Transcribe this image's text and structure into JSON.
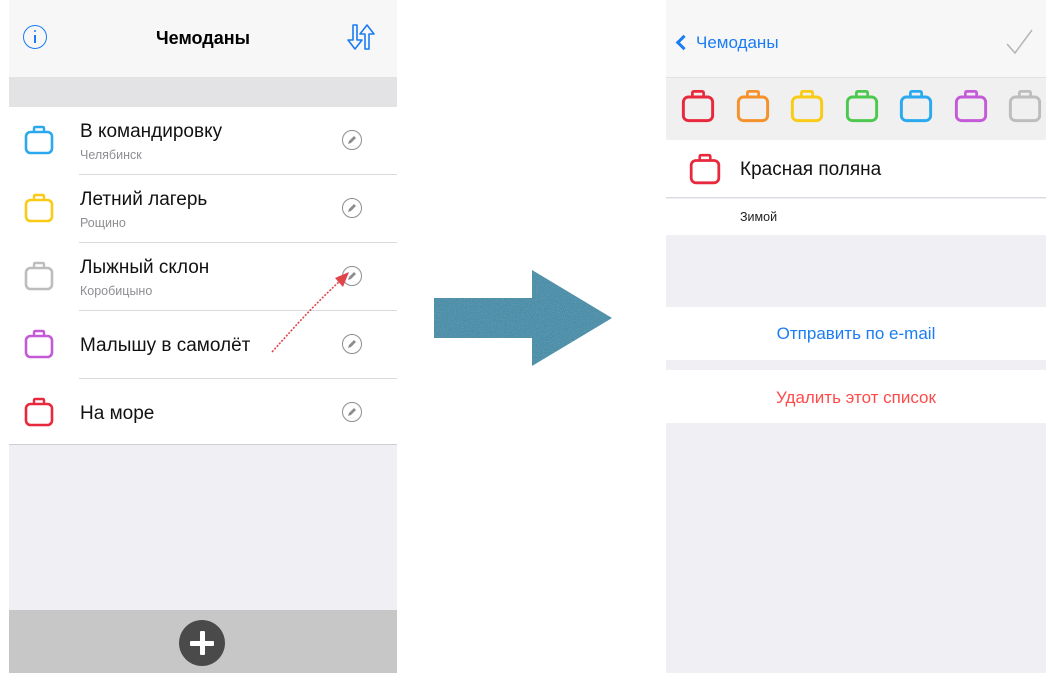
{
  "left": {
    "title": "Чемоданы",
    "icons": {
      "info": "info-icon",
      "sort": "sort-arrows-icon",
      "add": "plus-icon",
      "edit": "pencil-icon"
    },
    "items": [
      {
        "title": "В командировку",
        "subtitle": "Челябинск",
        "color": "#2aa9ef"
      },
      {
        "title": "Летний лагерь",
        "subtitle": "Рощино",
        "color": "#f9cb16"
      },
      {
        "title": "Лыжный склон",
        "subtitle": "Коробицыно",
        "color": "#bdbdbd"
      },
      {
        "title": "Малышу в самолёт",
        "subtitle": "",
        "color": "#c45ad8"
      },
      {
        "title": "На море",
        "subtitle": "",
        "color": "#e8293d"
      }
    ]
  },
  "right": {
    "back_label": "Чемоданы",
    "icons": {
      "back": "chevron-left-icon",
      "save": "checkmark-icon"
    },
    "colors": [
      "#e8293d",
      "#f5912a",
      "#f9cb16",
      "#4dc84f",
      "#2aa9ef",
      "#c45ad8",
      "#bdbdbd"
    ],
    "selected_color": "#e8293d",
    "name_value": "Красная поляна",
    "description_value": "Зимой",
    "email_button": "Отправить по e-mail",
    "delete_button": "Удалить этот список"
  },
  "colors": {
    "accent": "#1b7cf4",
    "destructive": "#ff4a4a",
    "arrow": "#2f8aa8",
    "annotation": "#e0454a"
  }
}
